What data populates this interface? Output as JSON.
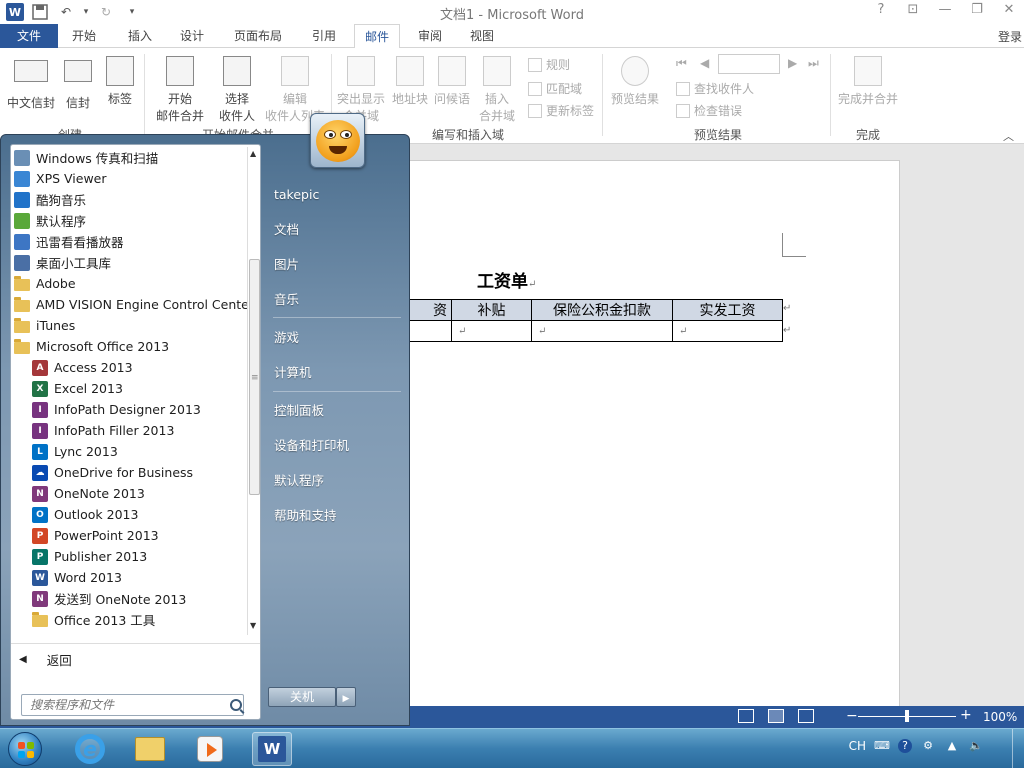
{
  "window": {
    "title": "文档1 - Microsoft Word",
    "controls": {
      "help": "?",
      "ribbon_opts": "⊡",
      "minimize": "—",
      "restore": "❐",
      "close": "✕"
    }
  },
  "qat": {
    "save_icon": "save-icon",
    "undo": "↶",
    "undo_dd": "▾",
    "redo": "↻",
    "customize": "▾"
  },
  "tabs": {
    "file": "文件",
    "items": [
      "开始",
      "插入",
      "设计",
      "页面布局",
      "引用",
      "邮件",
      "审阅",
      "视图"
    ],
    "active": "邮件",
    "login": "登录"
  },
  "ribbon": {
    "groups": {
      "create": "创建",
      "start_merge": "开始邮件合并",
      "write_insert": "编写和插入域",
      "preview": "预览结果",
      "finish": "完成"
    },
    "buttons": {
      "chinese_envelope": "中文信封",
      "envelope": "信封",
      "labels": "标签",
      "start_merge_1": "开始",
      "start_merge_2": "邮件合并",
      "select_recipients_1": "选择",
      "select_recipients_2": "收件人",
      "edit_list_1": "编辑",
      "edit_list_2": "收件人列表",
      "highlight_1": "突出显示",
      "highlight_2": "合并域",
      "address_block": "地址块",
      "greeting": "问候语",
      "insert_field_1": "插入",
      "insert_field_2": "合并域",
      "rules": "规则",
      "match_fields": "匹配域",
      "update_labels": "更新标签",
      "preview_results": "预览结果",
      "find_recipient": "查找收件人",
      "check_errors": "检查错误",
      "finish_merge": "完成并合并"
    },
    "nav_first": "⏮",
    "nav_prev": "◀",
    "nav_next": "▶",
    "nav_last": "⏭",
    "collapse": "︿"
  },
  "document": {
    "heading": "工资单",
    "para_mark": "↵",
    "table_headers": [
      "资",
      "补贴",
      "保险公积金扣款",
      "实发工资"
    ],
    "table_row": [
      "↵",
      "↵",
      "↵",
      "↵"
    ]
  },
  "status": {
    "zoom_level": "100%",
    "zoom_fraction": 0.5,
    "minus": "−",
    "plus": "+"
  },
  "start_menu": {
    "programs": [
      {
        "label": "Windows 传真和扫描",
        "icon": "fax-icon",
        "indent": false,
        "color": "#6a8fb5"
      },
      {
        "label": "XPS Viewer",
        "icon": "xps-icon",
        "indent": false,
        "color": "#3a86d4"
      },
      {
        "label": "酷狗音乐",
        "icon": "kugou-icon",
        "indent": false,
        "color": "#2173c9"
      },
      {
        "label": "默认程序",
        "icon": "default-programs-icon",
        "indent": false,
        "color": "#5aa83a"
      },
      {
        "label": "迅雷看看播放器",
        "icon": "xunlei-icon",
        "indent": false,
        "color": "#3d76c4"
      },
      {
        "label": "桌面小工具库",
        "icon": "gadgets-icon",
        "indent": false,
        "color": "#4a6fa5"
      },
      {
        "label": "Adobe",
        "icon": "folder-icon",
        "indent": false,
        "color": ""
      },
      {
        "label": "AMD VISION Engine Control Center",
        "icon": "folder-icon",
        "indent": false,
        "color": ""
      },
      {
        "label": "iTunes",
        "icon": "folder-icon",
        "indent": false,
        "color": ""
      },
      {
        "label": "Microsoft Office 2013",
        "icon": "folder-icon",
        "indent": false,
        "color": ""
      },
      {
        "label": "Access 2013",
        "icon": "access-icon",
        "indent": true,
        "color": "#a4373a",
        "glyph": "A"
      },
      {
        "label": "Excel 2013",
        "icon": "excel-icon",
        "indent": true,
        "color": "#217346",
        "glyph": "X"
      },
      {
        "label": "InfoPath Designer 2013",
        "icon": "infopath-designer-icon",
        "indent": true,
        "color": "#77337f",
        "glyph": "I"
      },
      {
        "label": "InfoPath Filler 2013",
        "icon": "infopath-filler-icon",
        "indent": true,
        "color": "#77337f",
        "glyph": "I"
      },
      {
        "label": "Lync 2013",
        "icon": "lync-icon",
        "indent": true,
        "color": "#0072c6",
        "glyph": "L"
      },
      {
        "label": "OneDrive for Business",
        "icon": "onedrive-icon",
        "indent": true,
        "color": "#094ab2",
        "glyph": "☁"
      },
      {
        "label": "OneNote 2013",
        "icon": "onenote-icon",
        "indent": true,
        "color": "#80397b",
        "glyph": "N"
      },
      {
        "label": "Outlook 2013",
        "icon": "outlook-icon",
        "indent": true,
        "color": "#0072c6",
        "glyph": "O"
      },
      {
        "label": "PowerPoint 2013",
        "icon": "powerpoint-icon",
        "indent": true,
        "color": "#d24726",
        "glyph": "P"
      },
      {
        "label": "Publisher 2013",
        "icon": "publisher-icon",
        "indent": true,
        "color": "#077568",
        "glyph": "P"
      },
      {
        "label": "Word 2013",
        "icon": "word-icon",
        "indent": true,
        "color": "#2b579a",
        "glyph": "W"
      },
      {
        "label": "发送到 OneNote 2013",
        "icon": "send-to-onenote-icon",
        "indent": true,
        "color": "#80397b",
        "glyph": "N"
      },
      {
        "label": "Office 2013 工具",
        "icon": "folder-icon",
        "indent": true,
        "color": ""
      }
    ],
    "back": "返回",
    "search_placeholder": "搜索程序和文件",
    "right_items": [
      "takepic",
      "文档",
      "图片",
      "音乐",
      "游戏",
      "计算机",
      "控制面板",
      "设备和打印机",
      "默认程序",
      "帮助和支持"
    ],
    "shutdown": "关机"
  },
  "taskbar": {
    "tray_lang": "CH",
    "items": [
      "start-orb",
      "internet-explorer-icon",
      "file-explorer-icon",
      "media-player-icon",
      "word-taskbar-icon"
    ]
  },
  "colors": {
    "word_blue": "#2b579a",
    "taskbar": "#3b7fb0",
    "header_fill": "#d0d8e4"
  }
}
